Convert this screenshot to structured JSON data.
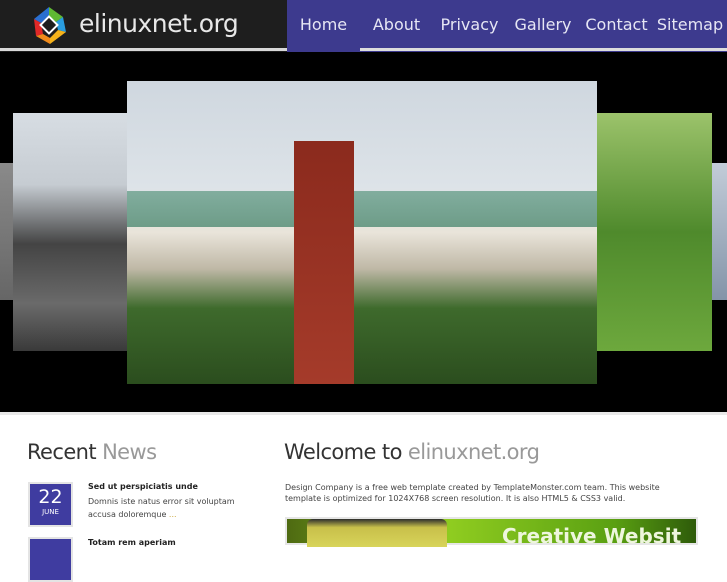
{
  "site": {
    "name": "elinuxnet.org"
  },
  "nav": [
    {
      "label": "Home",
      "active": true
    },
    {
      "label": "About"
    },
    {
      "label": "Privacy"
    },
    {
      "label": "Gallery"
    },
    {
      "label": "Contact"
    },
    {
      "label": "Sitemap"
    }
  ],
  "news": {
    "title_dark": "Recent",
    "title_light": "News",
    "items": [
      {
        "day": "22",
        "month": "JUNE",
        "title": "Sed ut perspiciatis unde",
        "text": "Domnis iste natus error sit voluptam accusa doloremque",
        "more": "..."
      },
      {
        "day": "",
        "month": "",
        "title": "Totam rem aperiam"
      }
    ]
  },
  "welcome": {
    "title_dark": "Welcome to",
    "title_light": "elinuxnet.org",
    "text": "Design Company is a free web template created by TemplateMonster.com team. This website template is optimized for 1024X768 screen resolution. It is also HTML5 & CSS3 valid.",
    "banner_text": "Creative Websit"
  },
  "colors": {
    "nav_bg": "#3d3a8e",
    "header_bg": "#1e1e1e",
    "date_bg": "#3f3ca0"
  }
}
